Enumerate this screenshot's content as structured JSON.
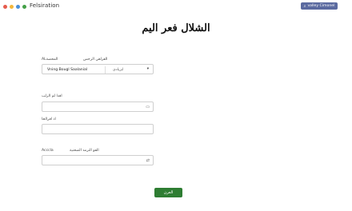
{
  "app": {
    "title": "Felsiration"
  },
  "window_controls": [
    {
      "name": "red",
      "color": "#e55b4d"
    },
    {
      "name": "yellow",
      "color": "#f3b73b"
    },
    {
      "name": "blue",
      "color": "#4a90d9"
    },
    {
      "name": "green",
      "color": "#43a047"
    }
  ],
  "header_button": {
    "label": "valley Cimonel",
    "icon": "search-icon"
  },
  "form": {
    "heading": "الشلال فعر اليم",
    "name_field": {
      "label_left": "ALالمحصة",
      "label_right": "القراهي الرحس",
      "value": "Vning Bougl Saalanial",
      "secondary_value": "ابريادي"
    },
    "address_field": {
      "label": "اقدا لم الرلب",
      "icon": "calendar-icon"
    },
    "city_field": {
      "label": "اذ اقرالخا"
    },
    "notes_field": {
      "label": "الفو الترمد الصحنية",
      "label_prefix": "Acccla",
      "icon": "swap-icon"
    },
    "submit_label": "العرن"
  },
  "colors": {
    "accent": "#2e7d32",
    "header_button": "#5b6aa0"
  }
}
